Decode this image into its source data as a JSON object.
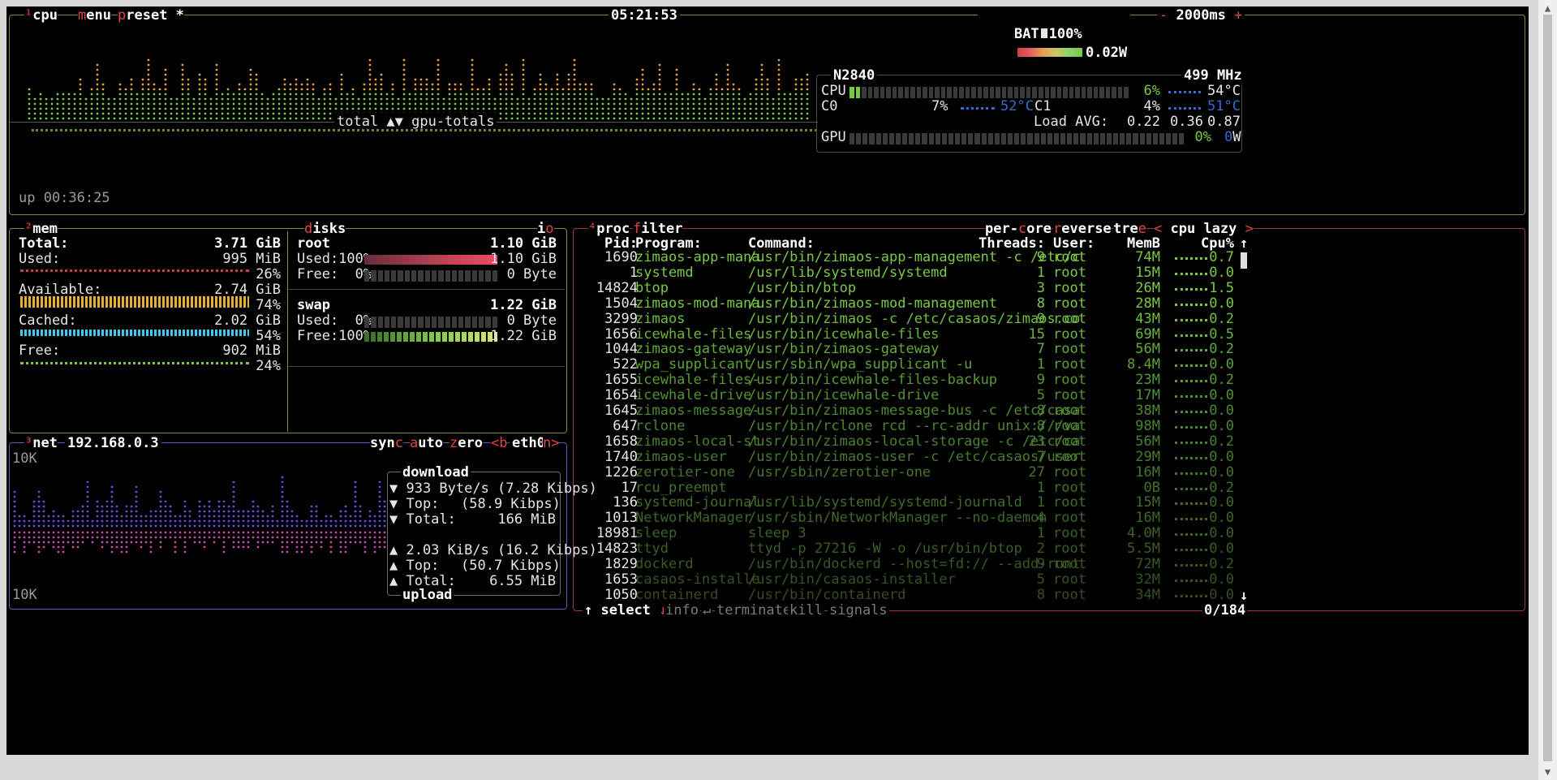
{
  "cpu_box": {
    "num": "¹",
    "title": "cpu",
    "menu_hot": "m",
    "menu_rest": "enu",
    "preset_hot": "p",
    "preset_rest": "reset *",
    "clock": "05:21:53",
    "battery_label": "BAT",
    "battery_pct": "100%",
    "battery_level": 1.0,
    "power": "0.02W",
    "minus": "-",
    "interval": "2000ms",
    "plus": "+",
    "graph_label": "total ▲▼ gpu-totals",
    "uptime": "up 00:36:25",
    "cpu_name": "N2840",
    "freq": "499 MHz",
    "cpu_label": "CPU",
    "cpu_pct": "6%",
    "cpu_temp": "54°C",
    "c0_label": "C0",
    "c0_pct": "7%",
    "c0_temp": "52°C",
    "c1_label": "C1",
    "c1_pct": "4%",
    "c1_temp": "51°C",
    "load_label": "Load AVG:",
    "load1": "0.22",
    "load5": "0.36",
    "load15": "0.87",
    "gpu_label": "GPU",
    "gpu_pct": "0%",
    "gpu_power_zero": "0",
    "gpu_power_unit": "W"
  },
  "mem_box": {
    "num": "²",
    "title": "mem",
    "disks_hot": "d",
    "disks_rest": "isks",
    "io_rest": "i",
    "io_hot": "o",
    "total_label": "Total:",
    "total": "3.71 GiB",
    "used_label": "Used:",
    "used": "995 MiB",
    "used_pct": "26%",
    "available_label": "Available:",
    "available": "2.74 GiB",
    "available_pct": "74%",
    "cached_label": "Cached:",
    "cached": "2.02 GiB",
    "cached_pct": "54%",
    "free_label": "Free:",
    "free": "902 MiB",
    "free_pct": "24%",
    "root_label": "root",
    "root_size": "1.10 GiB",
    "root_used_label": "Used:100%",
    "root_used": "1.10 GiB",
    "root_free_label": "Free:  0%",
    "root_free": "0 Byte",
    "swap_label": "swap",
    "swap_size": "1.22 GiB",
    "swap_used_label": "Used:  0%",
    "swap_used": "0 Byte",
    "swap_free_label": "Free:100%",
    "swap_free": "1.22 GiB"
  },
  "net_box": {
    "num": "³",
    "title": "net",
    "ip": "192.168.0.3",
    "sync_rest": "syn",
    "sync_hot": "c",
    "auto_hot": "a",
    "auto_rest": "uto",
    "zero_hot": "z",
    "zero_rest": "ero",
    "prev": "<b",
    "iface": "eth0",
    "next": "n>",
    "scale_top": "10K",
    "scale_bottom": "10K",
    "download_label": "download",
    "dl_rate": "▼ 933 Byte/s (7.28 Kibps)",
    "dl_top_label": "▼ Top:",
    "dl_top": "(58.9 Kibps)",
    "dl_total_label": "▼ Total:",
    "dl_total": "166 MiB",
    "ul_rate": "▲ 2.03 KiB/s (16.2 Kibps)",
    "ul_top_label": "▲ Top:",
    "ul_top": "(50.7 Kibps)",
    "ul_total_label": "▲ Total:",
    "ul_total": "6.55 MiB",
    "upload_label": "upload"
  },
  "proc_box": {
    "num": "⁴",
    "title": "proc",
    "filter_hot": "f",
    "filter_rest": "ilter",
    "percore_a": "per-",
    "percore_hot": "c",
    "percore_b": "ore",
    "reverse_hot": "r",
    "reverse_rest": "everse",
    "tree_a": "tre",
    "tree_hot": "e",
    "sort_left": "<",
    "sort_label": "cpu lazy",
    "sort_right": ">",
    "headers": {
      "pid": "Pid:",
      "program": "Program:",
      "command": "Command:",
      "threads": "Threads:",
      "user": "User:",
      "mem": "MemB",
      "cpu": "Cpu%"
    },
    "scroll_up": "↑",
    "scroll_down": "↓",
    "rows": [
      {
        "pid": "1690",
        "program": "zimaos-app-mana",
        "command": "/usr/bin/zimaos-app-management -c /etc/c",
        "threads": "9",
        "user": "root",
        "mem": "74M",
        "cpu": "0.7",
        "color": "#7ac943"
      },
      {
        "pid": "1",
        "program": "systemd",
        "command": "/usr/lib/systemd/systemd",
        "threads": "1",
        "user": "root",
        "mem": "15M",
        "cpu": "0.0",
        "color": "#7ac943"
      },
      {
        "pid": "14824",
        "program": "btop",
        "command": "/usr/bin/btop",
        "threads": "3",
        "user": "root",
        "mem": "26M",
        "cpu": "1.5",
        "color": "#7ac943"
      },
      {
        "pid": "1504",
        "program": "zimaos-mod-mana",
        "command": "/usr/bin/zimaos-mod-management",
        "threads": "8",
        "user": "root",
        "mem": "28M",
        "cpu": "0.0",
        "color": "#7ac943"
      },
      {
        "pid": "3299",
        "program": "zimaos",
        "command": "/usr/bin/zimaos -c /etc/casaos/zimaos.co",
        "threads": "9",
        "user": "root",
        "mem": "43M",
        "cpu": "0.2",
        "color": "#72bf40"
      },
      {
        "pid": "1656",
        "program": "icewhale-files",
        "command": "/usr/bin/icewhale-files",
        "threads": "15",
        "user": "root",
        "mem": "69M",
        "cpu": "0.5",
        "color": "#6ab53d"
      },
      {
        "pid": "1044",
        "program": "zimaos-gateway",
        "command": "/usr/bin/zimaos-gateway",
        "threads": "7",
        "user": "root",
        "mem": "56M",
        "cpu": "0.2",
        "color": "#63ab3a"
      },
      {
        "pid": "522",
        "program": "wpa_supplicant",
        "command": "/usr/sbin/wpa_supplicant -u",
        "threads": "1",
        "user": "root",
        "mem": "8.4M",
        "cpu": "0.0",
        "color": "#5da237"
      },
      {
        "pid": "1655",
        "program": "icewhale-files-",
        "command": "/usr/bin/icewhale-files-backup",
        "threads": "9",
        "user": "root",
        "mem": "23M",
        "cpu": "0.2",
        "color": "#579934"
      },
      {
        "pid": "1654",
        "program": "icewhale-drive",
        "command": "/usr/bin/icewhale-drive",
        "threads": "5",
        "user": "root",
        "mem": "17M",
        "cpu": "0.0",
        "color": "#529132"
      },
      {
        "pid": "1645",
        "program": "zimaos-message-",
        "command": "/usr/bin/zimaos-message-bus -c /etc/casa",
        "threads": "8",
        "user": "root",
        "mem": "38M",
        "cpu": "0.0",
        "color": "#4f8a30"
      },
      {
        "pid": "647",
        "program": "rclone",
        "command": "/usr/bin/rclone rcd --rc-addr unix:///va",
        "threads": "8",
        "user": "root",
        "mem": "98M",
        "cpu": "0.0",
        "color": "#4c842f"
      },
      {
        "pid": "1658",
        "program": "zimaos-local-st",
        "command": "/usr/bin/zimaos-local-storage -c /etc/ca",
        "threads": "23",
        "user": "root",
        "mem": "56M",
        "cpu": "0.2",
        "color": "#4a7f2e"
      },
      {
        "pid": "1740",
        "program": "zimaos-user",
        "command": "/usr/bin/zimaos-user -c /etc/casaos/user",
        "threads": "7",
        "user": "root",
        "mem": "29M",
        "cpu": "0.0",
        "color": "#487a2d"
      },
      {
        "pid": "1226",
        "program": "zerotier-one",
        "command": "/usr/sbin/zerotier-one",
        "threads": "27",
        "user": "root",
        "mem": "16M",
        "cpu": "0.0",
        "color": "#46752c"
      },
      {
        "pid": "17",
        "program": "rcu_preempt",
        "command": "",
        "threads": "1",
        "user": "root",
        "mem": "0B",
        "cpu": "0.2",
        "color": "#44702b"
      },
      {
        "pid": "136",
        "program": "systemd-journal",
        "command": "/usr/lib/systemd/systemd-journald",
        "threads": "1",
        "user": "root",
        "mem": "15M",
        "cpu": "0.0",
        "color": "#426b2a"
      },
      {
        "pid": "1013",
        "program": "NetworkManager",
        "command": "/usr/sbin/NetworkManager --no-daemon",
        "threads": "4",
        "user": "root",
        "mem": "16M",
        "cpu": "0.0",
        "color": "#406629"
      },
      {
        "pid": "18981",
        "program": "sleep",
        "command": "sleep 3",
        "threads": "1",
        "user": "root",
        "mem": "4.0M",
        "cpu": "0.0",
        "color": "#3e6128"
      },
      {
        "pid": "14823",
        "program": "ttyd",
        "command": "ttyd -p 27216 -W -o /usr/bin/btop",
        "threads": "2",
        "user": "root",
        "mem": "5.5M",
        "cpu": "0.0",
        "color": "#3c5c27"
      },
      {
        "pid": "1829",
        "program": "dockerd",
        "command": "/usr/bin/dockerd --host=fd:// --add-runt",
        "threads": "9",
        "user": "root",
        "mem": "72M",
        "cpu": "0.2",
        "color": "#3a5726"
      },
      {
        "pid": "1653",
        "program": "casaos-installe",
        "command": "/usr/bin/casaos-installer",
        "threads": "5",
        "user": "root",
        "mem": "32M",
        "cpu": "0.0",
        "color": "#385225"
      },
      {
        "pid": "1050",
        "program": "containerd",
        "command": "/usr/bin/containerd",
        "threads": "8",
        "user": "root",
        "mem": "34M",
        "cpu": "0.0",
        "color": "#364d24"
      }
    ],
    "footer": {
      "up": "↑",
      "select": "select",
      "down": "↓",
      "info": "info",
      "enter": "↵",
      "terminate": "terminate",
      "kill": "kill",
      "signals": "signals",
      "count": "0/184"
    }
  },
  "colors": {
    "cpu_box": "#7f8a3a",
    "mem_box": "#7f8a3a",
    "net_box": "#5a5ab0",
    "proc_box": "#a03a3a",
    "hot": "#e04545",
    "graph_low": "#7ac943",
    "graph_high": "#e8a040"
  }
}
